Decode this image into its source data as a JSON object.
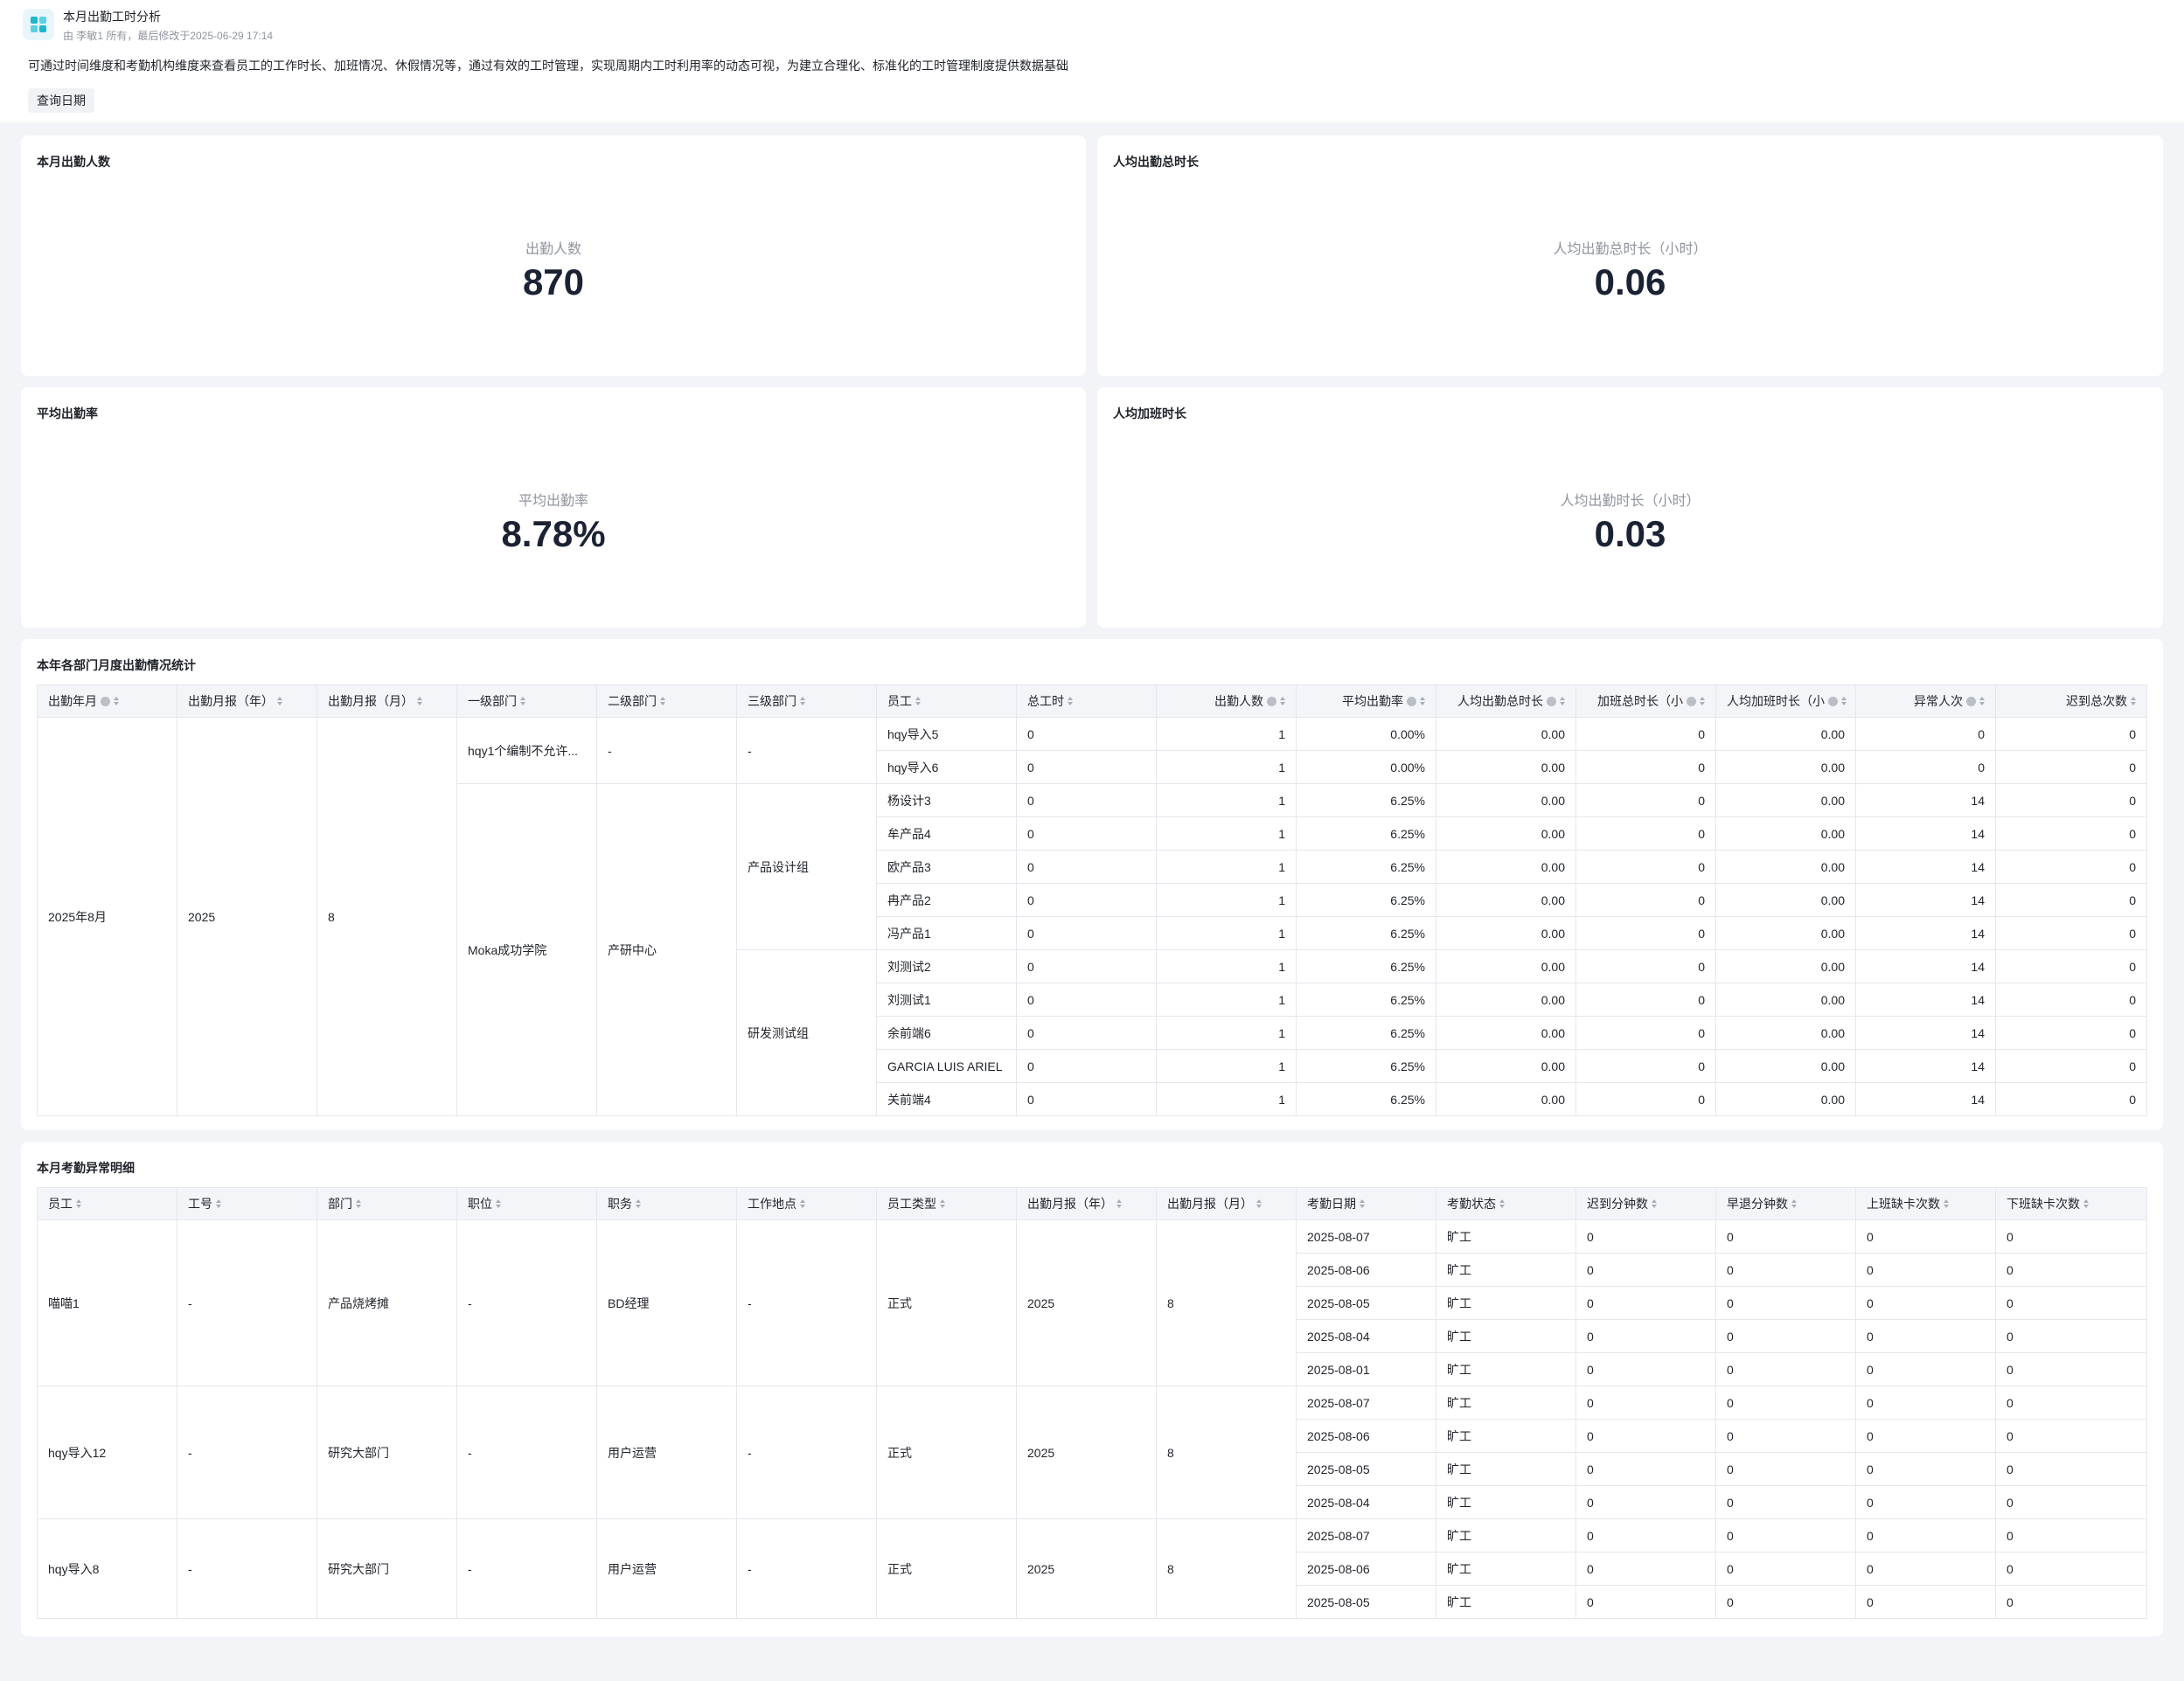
{
  "header": {
    "title": "本月出勤工时分析",
    "meta": "由 李敏1 所有，最后修改于2025-06-29 17:14",
    "description": "可通过时间维度和考勤机构维度来查看员工的工作时长、加班情况、休假情况等，通过有效的工时管理，实现周期内工时利用率的动态可视，为建立合理化、标准化的工时管理制度提供数据基础",
    "query_date_label": "查询日期"
  },
  "kpis": {
    "attendance_count": {
      "title": "本月出勤人数",
      "label": "出勤人数",
      "value": "870"
    },
    "avg_total_hours": {
      "title": "人均出勤总时长",
      "label": "人均出勤总时长（小时）",
      "value": "0.06"
    },
    "avg_rate": {
      "title": "平均出勤率",
      "label": "平均出勤率",
      "value": "8.78%"
    },
    "avg_overtime": {
      "title": "人均加班时长",
      "label": "人均出勤时长（小时）",
      "value": "0.03"
    }
  },
  "dept_table": {
    "title": "本年各部门月度出勤情况统计",
    "headers": [
      "出勤年月",
      "出勤月报（年）",
      "出勤月报（月）",
      "一级部门",
      "二级部门",
      "三级部门",
      "员工",
      "总工时",
      "出勤人数",
      "平均出勤率",
      "人均出勤总时长",
      "加班总时长（小",
      "人均加班时长（小",
      "异常人次",
      "迟到总次数"
    ],
    "month": "2025年8月",
    "year": "2025",
    "mon": "8",
    "groups": [
      {
        "dept1": "hqy1个编制不允许...",
        "dept2": "-",
        "dept3": "-"
      },
      {
        "dept1": "Moka成功学院",
        "dept2": "产研中心",
        "dept3a": "产品设计组",
        "dept3b": "研发测试组"
      }
    ],
    "rows": [
      [
        "hqy导入5",
        "0",
        "1",
        "0.00%",
        "0.00",
        "0",
        "0.00",
        "0",
        "0"
      ],
      [
        "hqy导入6",
        "0",
        "1",
        "0.00%",
        "0.00",
        "0",
        "0.00",
        "0",
        "0"
      ],
      [
        "杨设计3",
        "0",
        "1",
        "6.25%",
        "0.00",
        "0",
        "0.00",
        "14",
        "0"
      ],
      [
        "牟产品4",
        "0",
        "1",
        "6.25%",
        "0.00",
        "0",
        "0.00",
        "14",
        "0"
      ],
      [
        "欧产品3",
        "0",
        "1",
        "6.25%",
        "0.00",
        "0",
        "0.00",
        "14",
        "0"
      ],
      [
        "冉产品2",
        "0",
        "1",
        "6.25%",
        "0.00",
        "0",
        "0.00",
        "14",
        "0"
      ],
      [
        "冯产品1",
        "0",
        "1",
        "6.25%",
        "0.00",
        "0",
        "0.00",
        "14",
        "0"
      ],
      [
        "刘测试2",
        "0",
        "1",
        "6.25%",
        "0.00",
        "0",
        "0.00",
        "14",
        "0"
      ],
      [
        "刘测试1",
        "0",
        "1",
        "6.25%",
        "0.00",
        "0",
        "0.00",
        "14",
        "0"
      ],
      [
        "余前端6",
        "0",
        "1",
        "6.25%",
        "0.00",
        "0",
        "0.00",
        "14",
        "0"
      ],
      [
        "GARCIA LUIS ARIEL",
        "0",
        "1",
        "6.25%",
        "0.00",
        "0",
        "0.00",
        "14",
        "0"
      ],
      [
        "关前端4",
        "0",
        "1",
        "6.25%",
        "0.00",
        "0",
        "0.00",
        "14",
        "0"
      ]
    ]
  },
  "anomaly_table": {
    "title": "本月考勤异常明细",
    "headers": [
      "员工",
      "工号",
      "部门",
      "职位",
      "职务",
      "工作地点",
      "员工类型",
      "出勤月报（年）",
      "出勤月报（月）",
      "考勤日期",
      "考勤状态",
      "迟到分钟数",
      "早退分钟数",
      "上班缺卡次数",
      "下班缺卡次数"
    ],
    "employees": [
      {
        "name": "喵喵1",
        "id": "-",
        "dept": "产品烧烤摊",
        "position": "-",
        "duty": "BD经理",
        "location": "-",
        "type": "正式",
        "year": "2025",
        "month": "8"
      },
      {
        "name": "hqy导入12",
        "id": "-",
        "dept": "研究大部门",
        "position": "-",
        "duty": "用户运营",
        "location": "-",
        "type": "正式",
        "year": "2025",
        "month": "8"
      },
      {
        "name": "hqy导入8",
        "id": "-",
        "dept": "研究大部门",
        "position": "-",
        "duty": "用户运营",
        "location": "-",
        "type": "正式",
        "year": "2025",
        "month": "8"
      }
    ],
    "rows": [
      [
        "2025-08-07",
        "旷工",
        "0",
        "0",
        "0",
        "0"
      ],
      [
        "2025-08-06",
        "旷工",
        "0",
        "0",
        "0",
        "0"
      ],
      [
        "2025-08-05",
        "旷工",
        "0",
        "0",
        "0",
        "0"
      ],
      [
        "2025-08-04",
        "旷工",
        "0",
        "0",
        "0",
        "0"
      ],
      [
        "2025-08-01",
        "旷工",
        "0",
        "0",
        "0",
        "0"
      ],
      [
        "2025-08-07",
        "旷工",
        "0",
        "0",
        "0",
        "0"
      ],
      [
        "2025-08-06",
        "旷工",
        "0",
        "0",
        "0",
        "0"
      ],
      [
        "2025-08-05",
        "旷工",
        "0",
        "0",
        "0",
        "0"
      ],
      [
        "2025-08-04",
        "旷工",
        "0",
        "0",
        "0",
        "0"
      ],
      [
        "2025-08-07",
        "旷工",
        "0",
        "0",
        "0",
        "0"
      ],
      [
        "2025-08-06",
        "旷工",
        "0",
        "0",
        "0",
        "0"
      ],
      [
        "2025-08-05",
        "旷工",
        "0",
        "0",
        "0",
        "0"
      ]
    ]
  }
}
